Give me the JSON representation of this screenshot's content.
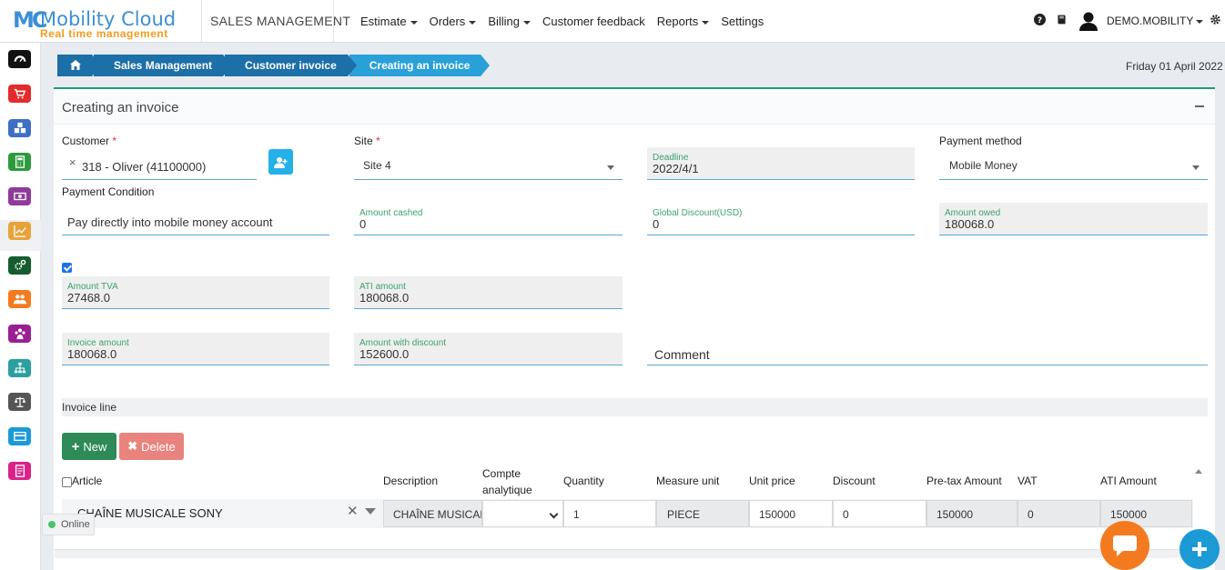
{
  "app": {
    "logo_mark": "MC",
    "brand": "Mobility Cloud",
    "tagline": "Real time management",
    "module": "SALES MANAGEMENT",
    "menu": [
      {
        "label": "Estimate",
        "dropdown": true
      },
      {
        "label": "Orders",
        "dropdown": true
      },
      {
        "label": "Billing",
        "dropdown": true
      },
      {
        "label": "Customer feedback",
        "dropdown": false
      },
      {
        "label": "Reports",
        "dropdown": true
      },
      {
        "label": "Settings",
        "dropdown": false
      }
    ],
    "user": "DEMO.MOBILITY"
  },
  "sidebar_icons": [
    {
      "name": "dashboard-icon",
      "color": "#111111"
    },
    {
      "name": "cart-icon",
      "color": "#e32b2b"
    },
    {
      "name": "cubes-icon",
      "color": "#3f6fc4"
    },
    {
      "name": "calculator-icon",
      "color": "#2e9a3e"
    },
    {
      "name": "money-icon",
      "color": "#8e3b9a"
    },
    {
      "name": "chart-line-icon",
      "color": "#e7a33a"
    },
    {
      "name": "cogs-icon",
      "color": "#155c2f"
    },
    {
      "name": "users-icon",
      "color": "#f47a20"
    },
    {
      "name": "team-icon",
      "color": "#9a1f93"
    },
    {
      "name": "sitemap-icon",
      "color": "#2aa0a0"
    },
    {
      "name": "balance-scale-icon",
      "color": "#555555"
    },
    {
      "name": "credit-card-icon",
      "color": "#1b9ad6"
    },
    {
      "name": "report-icon",
      "color": "#d8248a"
    }
  ],
  "breadcrumb": [
    "Sales Management",
    "Customer invoice",
    "Creating an invoice"
  ],
  "date": "Friday 01 April 2022",
  "form": {
    "title": "Creating an invoice",
    "customer_label": "Customer",
    "customer_value": "318 - Oliver (41100000)",
    "site_label": "Site",
    "site_value": "Site 4",
    "deadline_label": "Deadline",
    "deadline_value": "2022/4/1",
    "payment_method_label": "Payment method",
    "payment_method_value": "Mobile Money",
    "payment_condition_label": "Payment Condition",
    "payment_condition_value": "Pay directly into mobile money account",
    "amount_cashed_label": "Amount cashed",
    "amount_cashed_value": "0",
    "global_discount_label": "Global Discount(USD)",
    "global_discount_value": "0",
    "amount_owed_label": "Amount owed",
    "amount_owed_value": "180068.0",
    "tva_checked": true,
    "amount_tva_label": "Amount TVA",
    "amount_tva_value": "27468.0",
    "ati_amount_label": "ATI amount",
    "ati_amount_value": "180068.0",
    "invoice_amount_label": "Invoice amount",
    "invoice_amount_value": "180068.0",
    "amount_discount_label": "Amount with discount",
    "amount_discount_value": "152600.0",
    "comment_placeholder": "Comment"
  },
  "invoice_line": {
    "section_title": "Invoice line",
    "new_label": "New",
    "delete_label": "Delete",
    "headers": {
      "article": "Article",
      "description": "Description",
      "compte": "Compte",
      "analytique": "analytique",
      "quantity": "Quantity",
      "measure_unit": "Measure unit",
      "unit_price": "Unit price",
      "discount": "Discount",
      "pretax": "Pre-tax Amount",
      "vat": "VAT",
      "ati": "ATI Amount"
    },
    "row": {
      "article": "CHAÎNE MUSICALE SONY",
      "description": "CHAÎNE MUSICALE SONY",
      "quantity": "1",
      "measure_unit": "PIECE",
      "unit_price": "150000",
      "discount": "0",
      "pretax": "150000",
      "vat": "0",
      "ati": "150000"
    }
  },
  "status": {
    "online": "Online"
  }
}
